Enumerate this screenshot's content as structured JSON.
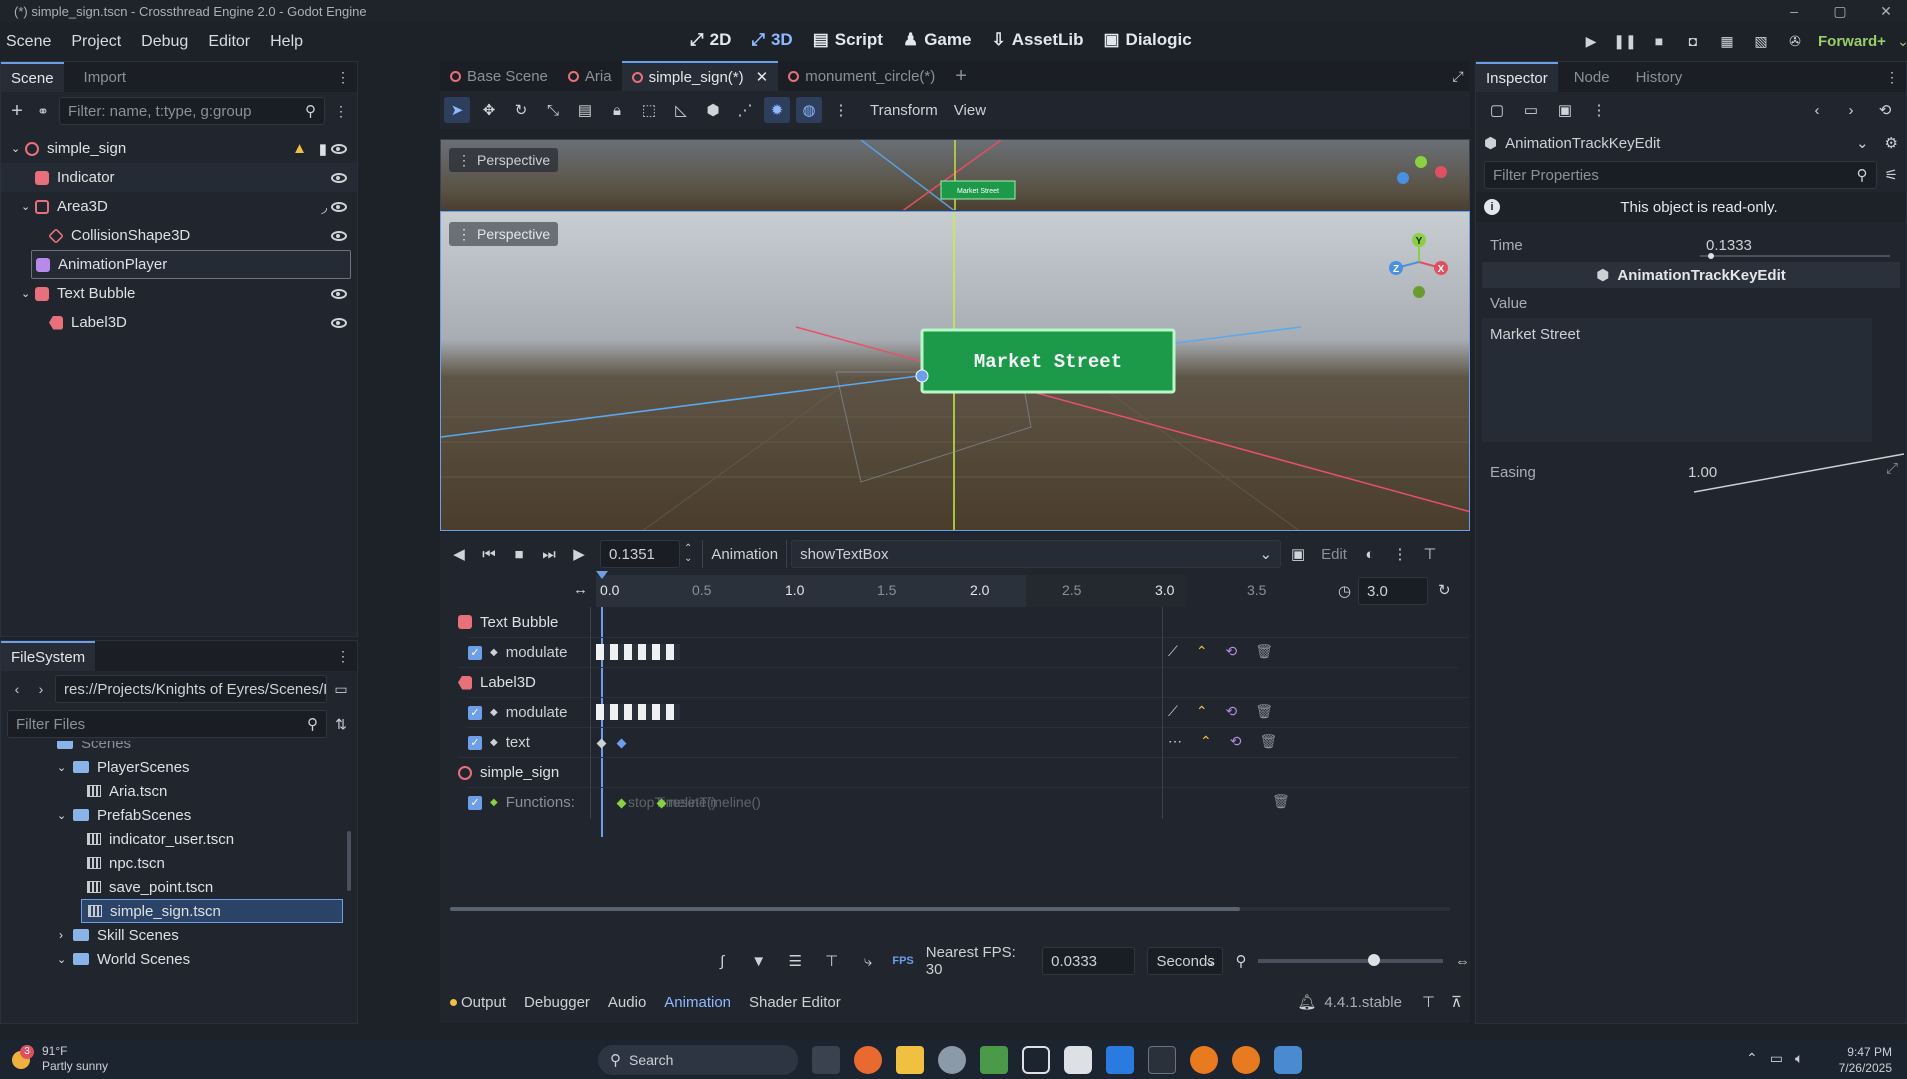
{
  "window": {
    "title": "(*) simple_sign.tscn - Crossthread Engine 2.0 - Godot Engine"
  },
  "menu": [
    "Scene",
    "Project",
    "Debug",
    "Editor",
    "Help"
  ],
  "workspaces": [
    "2D",
    "3D",
    "Script",
    "Game",
    "AssetLib",
    "Dialogic"
  ],
  "renderer": "Forward+",
  "scene_dock": {
    "tabs": [
      "Scene",
      "Import"
    ],
    "filter_placeholder": "Filter: name, t:type, g:group",
    "nodes": [
      {
        "name": "simple_sign",
        "color": "#e8707a"
      },
      {
        "name": "Indicator",
        "color": "#e8707a"
      },
      {
        "name": "Area3D",
        "color": "#e8707a"
      },
      {
        "name": "CollisionShape3D",
        "color": "#e8707a"
      },
      {
        "name": "AnimationPlayer",
        "color": "#b58ae8"
      },
      {
        "name": "Text Bubble",
        "color": "#e8707a"
      },
      {
        "name": "Label3D",
        "color": "#e8707a"
      }
    ]
  },
  "filesystem": {
    "title": "FileSystem",
    "path": "res://Projects/Knights of Eyres/Scenes/PrefabScene",
    "filter_placeholder": "Filter Files",
    "items": [
      {
        "name": "Scenes",
        "type": "folder"
      },
      {
        "name": "PlayerScenes",
        "type": "folder"
      },
      {
        "name": "Aria.tscn",
        "type": "scene"
      },
      {
        "name": "PrefabScenes",
        "type": "folder"
      },
      {
        "name": "indicator_user.tscn",
        "type": "scene"
      },
      {
        "name": "npc.tscn",
        "type": "scene"
      },
      {
        "name": "save_point.tscn",
        "type": "scene"
      },
      {
        "name": "simple_sign.tscn",
        "type": "scene"
      },
      {
        "name": "Skill Scenes",
        "type": "folder"
      },
      {
        "name": "World Scenes",
        "type": "folder"
      }
    ]
  },
  "scene_tabs": [
    "Base Scene",
    "Aria",
    "simple_sign(*)",
    "monument_circle(*)"
  ],
  "viewport_toolbar": {
    "transform": "Transform",
    "view": "View"
  },
  "viewport": {
    "perspective_label": "Perspective",
    "sign_text": "Market Street"
  },
  "animation": {
    "time": "0.1351",
    "animation_label": "Animation",
    "selected_animation": "showTextBox",
    "edit_label": "Edit",
    "ruler_ticks": [
      "0.0",
      "0.5",
      "1.0",
      "1.5",
      "2.0",
      "2.5",
      "3.0",
      "3.5"
    ],
    "length": "3.0",
    "tracks": [
      {
        "group": "Text Bubble",
        "color": "#e8707a",
        "props": [
          {
            "name": "modulate"
          }
        ]
      },
      {
        "group": "Label3D",
        "color": "#e8707a",
        "props": [
          {
            "name": "modulate"
          },
          {
            "name": "text"
          }
        ]
      },
      {
        "group": "simple_sign",
        "color": "#e8707a",
        "props": [
          {
            "name": "Functions:",
            "func_text": "stopTimeline()",
            "func_text2": "resetTimeline()"
          }
        ]
      }
    ],
    "snap_label": "Nearest FPS: 30",
    "snap_value": "0.0333",
    "units": "Seconds"
  },
  "bottom_tabs": [
    "Output",
    "Debugger",
    "Audio",
    "Animation",
    "Shader Editor"
  ],
  "version": "4.4.1.stable",
  "inspector": {
    "tabs": [
      "Inspector",
      "Node",
      "History"
    ],
    "object": "AnimationTrackKeyEdit",
    "filter_placeholder": "Filter Properties",
    "readonly": "This object is read-only.",
    "time_label": "Time",
    "time_value": "0.1333",
    "section": "AnimationTrackKeyEdit",
    "value_label": "Value",
    "value_text": "Market Street",
    "easing_label": "Easing",
    "easing_value": "1.00"
  },
  "taskbar": {
    "weather_temp": "91°F",
    "weather_desc": "Partly sunny",
    "weather_badge": "3",
    "search": "Search",
    "time": "9:47 PM",
    "date": "7/26/2025"
  }
}
